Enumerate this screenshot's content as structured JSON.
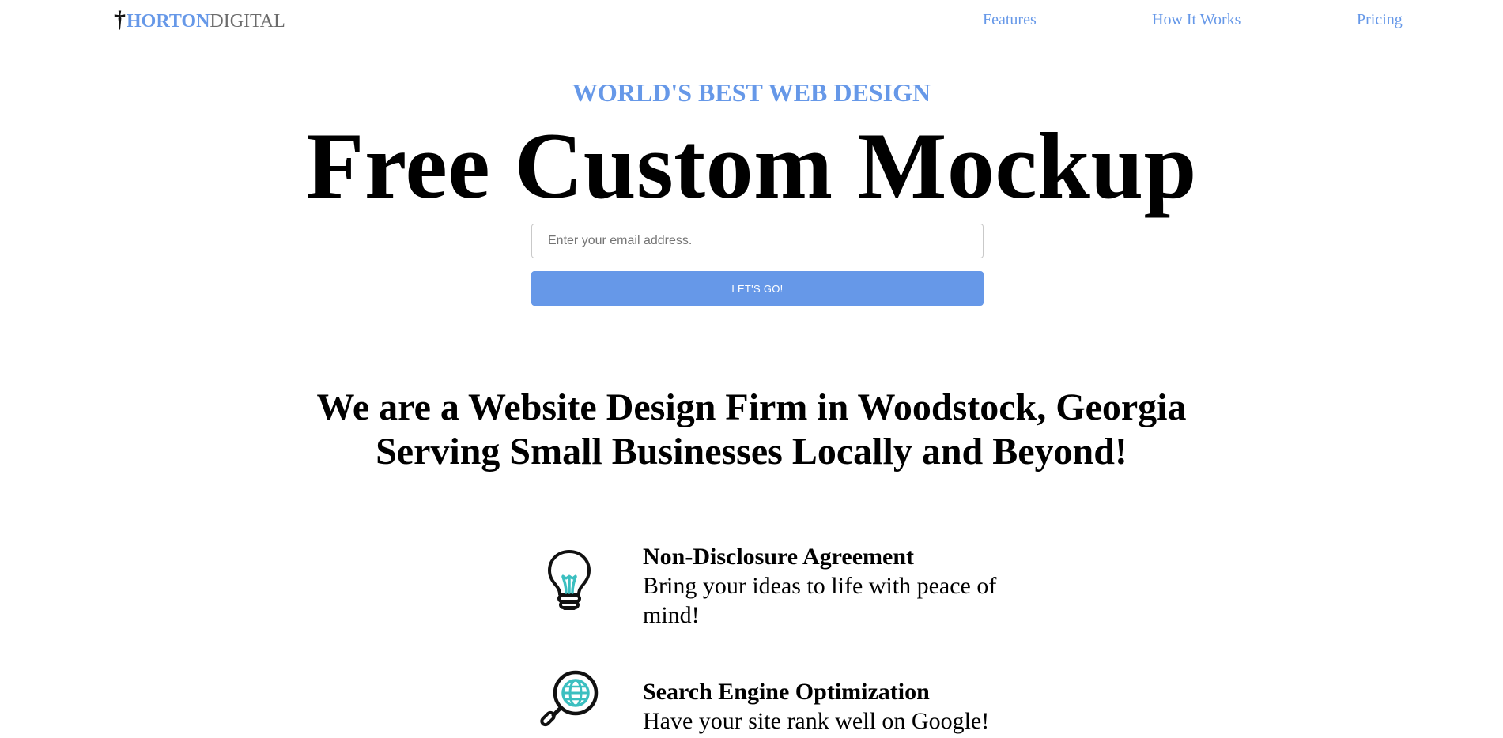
{
  "header": {
    "logo": {
      "cross": "†",
      "part1": "HORTON",
      "part2": "DIGITAL"
    },
    "nav": [
      "Features",
      "How It Works",
      "Pricing"
    ]
  },
  "hero": {
    "eyebrow": "WORLD'S BEST WEB DESIGN",
    "title": "Free Custom Mockup",
    "email_placeholder": "Enter your email address.",
    "email_value": "",
    "cta_label": "LET'S GO!"
  },
  "intro": {
    "line1": "We are a Website Design Firm in Woodstock, Georgia",
    "line2": "Serving Small Businesses Locally and Beyond!"
  },
  "features": [
    {
      "icon": "lightbulb-icon",
      "title": "Non-Disclosure Agreement",
      "desc": "Bring your ideas to life with peace of mind!"
    },
    {
      "icon": "magnifier-globe-icon",
      "title": "Search Engine Optimization",
      "desc": "Have your site rank well on Google!"
    }
  ],
  "colors": {
    "accent": "#6698e8",
    "text": "#000000",
    "muted": "#6b6b6b",
    "icon_teal": "#3bbfc0"
  }
}
